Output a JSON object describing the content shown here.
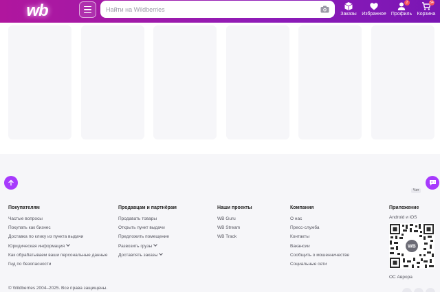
{
  "header": {
    "logo": "wb",
    "search_placeholder": "Найти на Wildberries",
    "nav": [
      {
        "label": "Заказы",
        "icon": "box-icon",
        "badge": ""
      },
      {
        "label": "Избранное",
        "icon": "heart-icon",
        "badge": ""
      },
      {
        "label": "Профиль",
        "icon": "user-icon",
        "badge": "2"
      },
      {
        "label": "Корзина",
        "icon": "cart-icon",
        "badge": "54"
      }
    ]
  },
  "footer": {
    "columns": [
      {
        "title": "Покупателям",
        "links": [
          "Частые вопросы",
          "Покупать как бизнес",
          "Доставка по клику из пункта выдачи",
          "Юридическая информация",
          "Как обрабатываем ваши персональные данные",
          "Гид по безопасности"
        ]
      },
      {
        "title": "Продавцам и партнёрам",
        "links": [
          "Продавать товары",
          "Открыть пункт выдачи",
          "Предложить помещение",
          "Развозить грузы",
          "Доставлять заказы"
        ]
      },
      {
        "title": "Наши проекты",
        "links": [
          "WB Guru",
          "WB Stream",
          "WB Track"
        ]
      },
      {
        "title": "Компания",
        "links": [
          "О нас",
          "Пресс-служба",
          "Контакты",
          "Вакансии",
          "Сообщить о мошенничестве",
          "Социальные сети"
        ]
      }
    ],
    "app": {
      "title": "Приложение",
      "platforms": "Android и iOS",
      "aurora": "ОС Аврора",
      "qr_label": "WB"
    },
    "copyright": "© Wildberries 2004–2025. Все права защищены."
  },
  "chat_tip": "Чат",
  "colors": {
    "accent": "#a73afd",
    "header_start": "#b0169e",
    "header_end": "#7a16b4",
    "badge": "#f5515f"
  }
}
